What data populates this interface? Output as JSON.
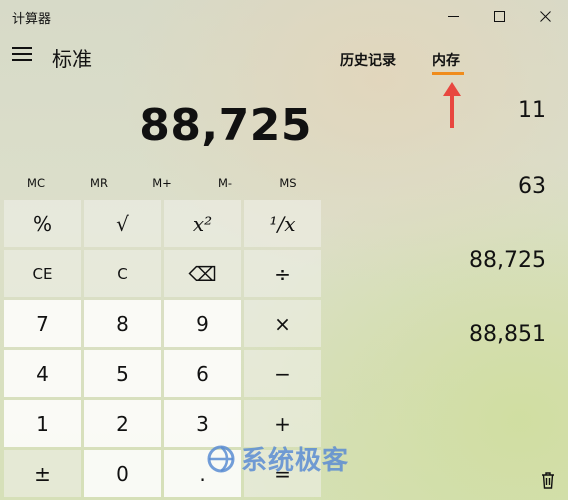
{
  "window": {
    "title": "计算器"
  },
  "header": {
    "mode": "标准",
    "tabs": [
      "历史记录",
      "内存"
    ]
  },
  "display": {
    "value": "88,725"
  },
  "memory_buttons": [
    "MC",
    "MR",
    "M+",
    "M-",
    "MS"
  ],
  "keys": [
    [
      "%",
      "√",
      "x²",
      "¹∕x"
    ],
    [
      "CE",
      "C",
      "⌫",
      "÷"
    ],
    [
      "7",
      "8",
      "9",
      "×"
    ],
    [
      "4",
      "5",
      "6",
      "−"
    ],
    [
      "1",
      "2",
      "3",
      "+"
    ],
    [
      "±",
      "0",
      ".",
      "="
    ]
  ],
  "memory_list": [
    "11",
    "63",
    "88,725",
    "88,851"
  ],
  "watermark": {
    "text": "系统极客"
  },
  "colors": {
    "accent": "#f08c1c",
    "arrow": "#e8473f",
    "watermark": "#5a8cd2"
  }
}
